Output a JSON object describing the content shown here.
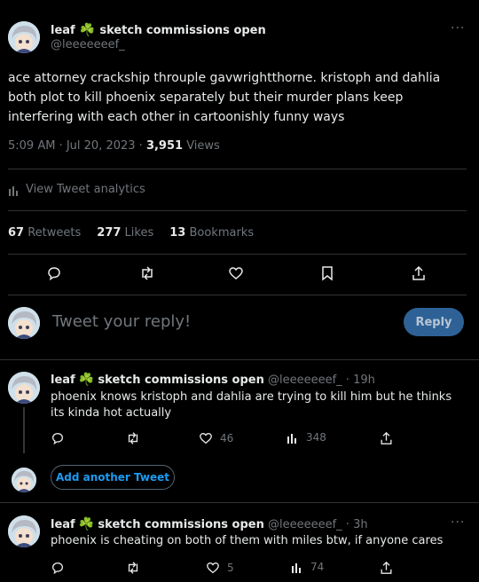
{
  "main_tweet": {
    "display_name": "leaf",
    "name_suffix": "sketch commissions open",
    "handle": "@leeeeeeef_",
    "text": "ace attorney crackship throuple gavwrightthorne. kristoph and dahlia both plot to kill phoenix separately but their murder plans keep interfering with each other in cartoonishly funny ways",
    "timestamp": "5:09 AM · Jul 20, 2023 · ",
    "views_count": "3,951",
    "views_label": " Views",
    "analytics_label": "View Tweet analytics",
    "retweets_count": "67",
    "retweets_label": " Retweets",
    "likes_count": "277",
    "likes_label": " Likes",
    "bookmarks_count": "13",
    "bookmarks_label": " Bookmarks"
  },
  "compose": {
    "placeholder": "Tweet your reply!",
    "reply_label": "Reply"
  },
  "replies": [
    {
      "display_name": "leaf",
      "name_suffix": "sketch commissions open",
      "handle_time": "@leeeeeeef_ · 19h",
      "text": "phoenix knows kristoph and dahlia are trying to kill him but he thinks its kinda hot actually",
      "likes": "46",
      "views": "348"
    },
    {
      "display_name": "leaf",
      "name_suffix": "sketch commissions open",
      "handle_time": "@leeeeeeef_ · 3h",
      "text": "phoenix is cheating on both of them with miles btw, if anyone cares",
      "likes": "5",
      "views": "74"
    }
  ],
  "add_another_label": "Add another Tweet",
  "more_glyph": "···",
  "clover_glyph": "☘️",
  "colors": {
    "accent": "#1d9bf0",
    "muted": "#71767b",
    "divider": "#2f3336",
    "reply_button_bg": "#2e6296"
  }
}
